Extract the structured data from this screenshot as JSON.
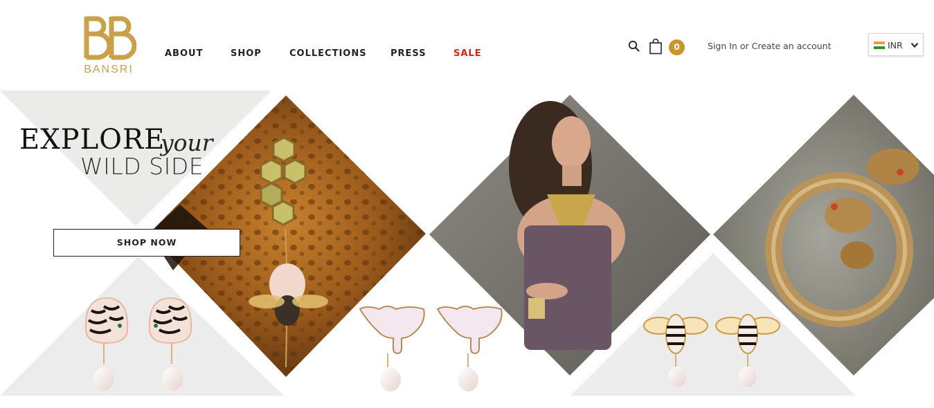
{
  "brand": {
    "name": "BANSRI",
    "color": "#c9a14a"
  },
  "nav": {
    "items": [
      {
        "label": "ABOUT"
      },
      {
        "label": "SHOP"
      },
      {
        "label": "COLLECTIONS"
      },
      {
        "label": "PRESS"
      },
      {
        "label": "SALE",
        "color": "#e21b1b"
      }
    ]
  },
  "header_tools": {
    "search_icon": "search-icon",
    "cart_icon": "shopping-bag-icon",
    "cart_count": "0",
    "cart_badge_color": "#c9962b",
    "sign_in": "Sign In",
    "or": "or",
    "create_account": "Create an account",
    "currency": {
      "selected": "INR",
      "flag": "india-flag-icon"
    }
  },
  "hero": {
    "headline_word1": "EXPLORE",
    "headline_word2": "your",
    "headline_line2": "WILD SIDE",
    "cta_label": "SHOP NOW",
    "images": [
      "honeycomb-bee-earring-photo",
      "zebra-pearl-earrings",
      "elephant-pearl-earrings",
      "model-wearing-necklace-photo",
      "bee-pearl-earrings",
      "panther-cuff-bracelet-photo"
    ]
  }
}
